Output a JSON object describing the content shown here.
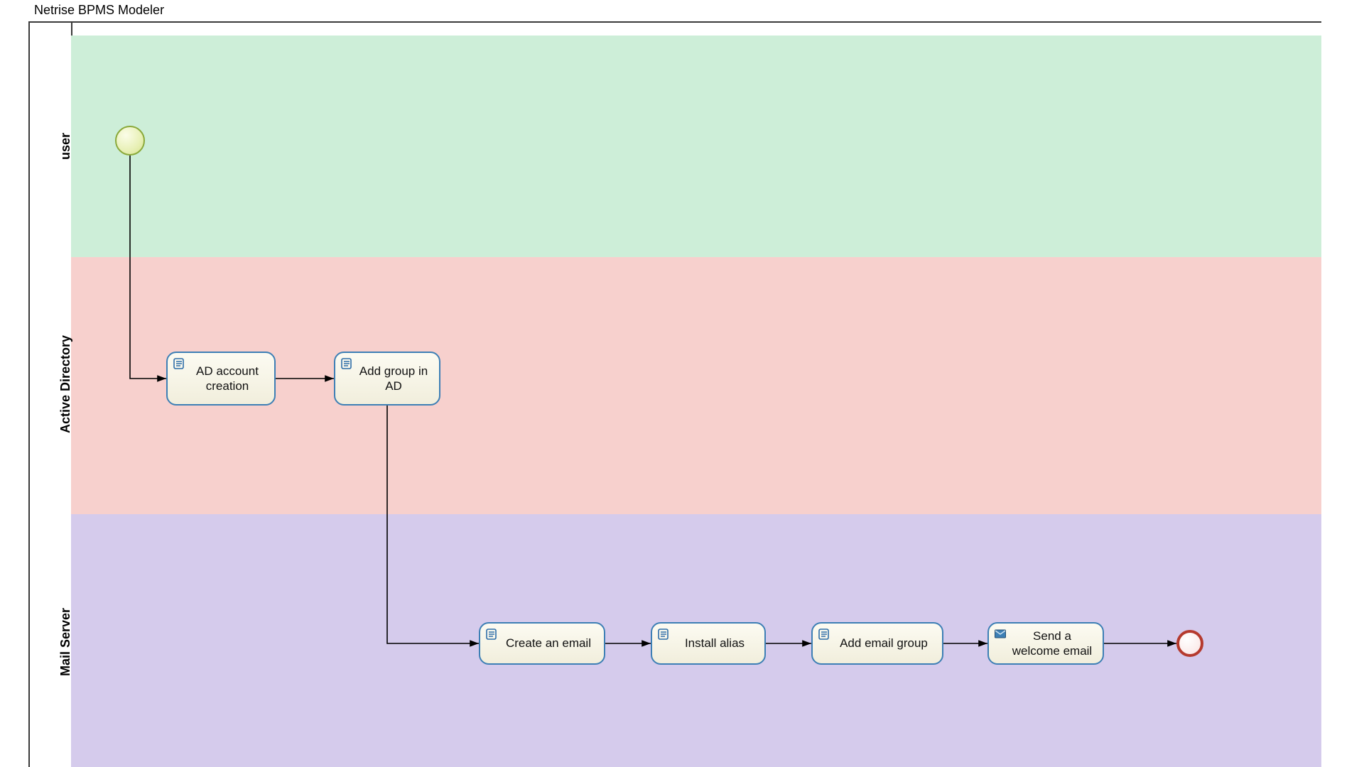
{
  "app_title": "Netrise BPMS Modeler",
  "lanes": {
    "user": "user",
    "ad": "Active Directory",
    "mail": "Mail Server"
  },
  "tasks": {
    "ad_account": "AD account creation",
    "add_group_ad": "Add group in AD",
    "create_email": "Create an email",
    "install_alias": "Install alias",
    "add_email_group": "Add email group",
    "send_welcome": "Send a welcome email"
  },
  "events": {
    "start": "start-event",
    "end": "end-event"
  },
  "icons": {
    "script": "script-icon",
    "message": "message-icon"
  }
}
